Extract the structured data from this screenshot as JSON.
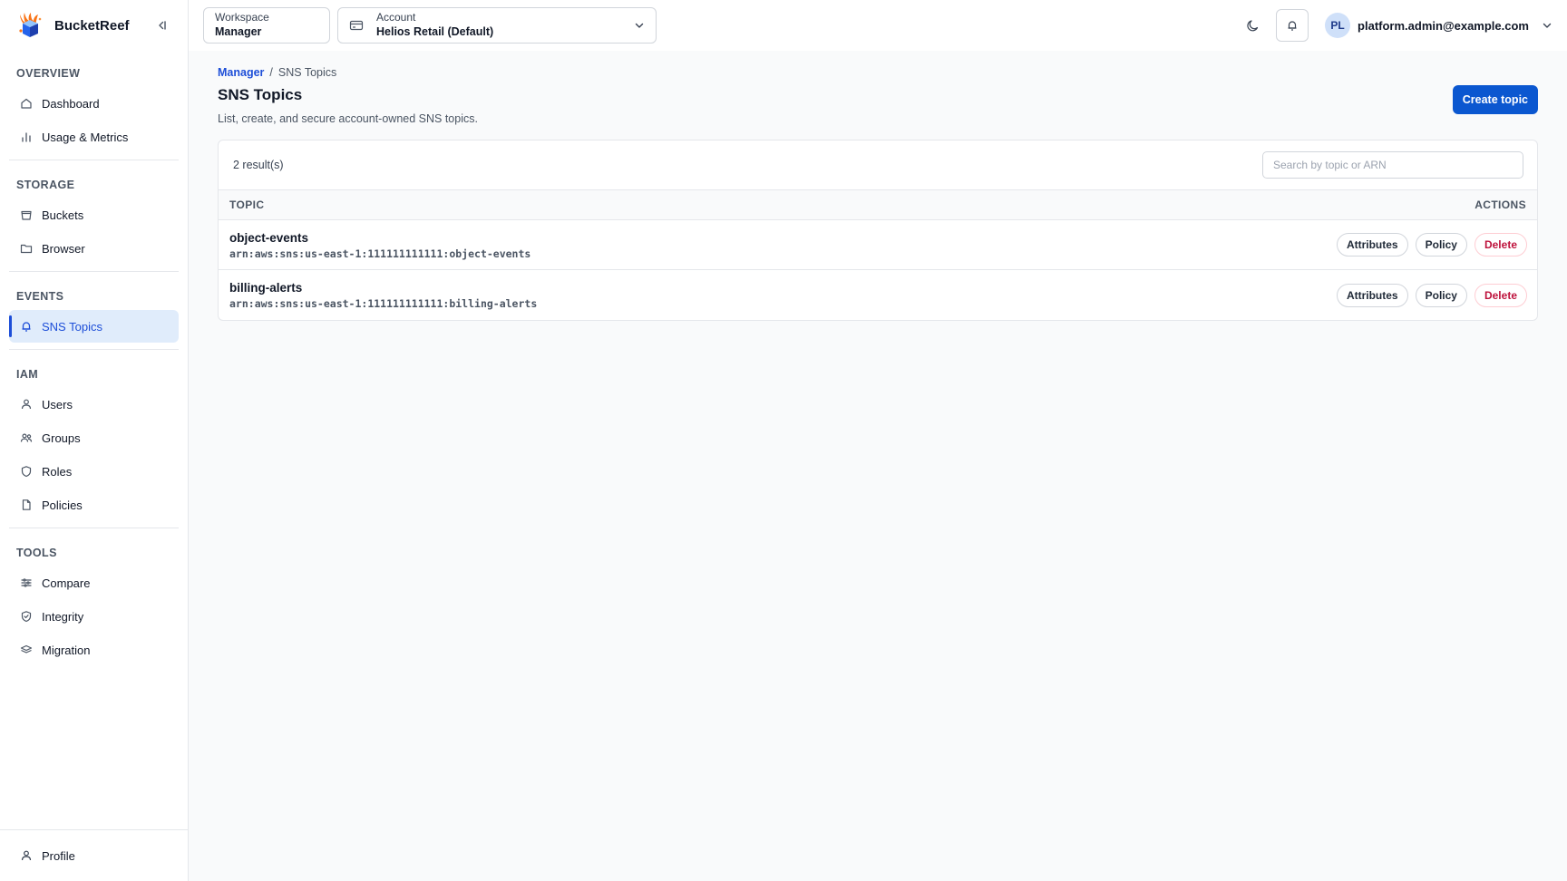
{
  "brand": {
    "name": "BucketReef"
  },
  "sidebar": {
    "sections": [
      {
        "title": "OVERVIEW",
        "items": [
          {
            "label": "Dashboard",
            "icon": "home-icon"
          },
          {
            "label": "Usage & Metrics",
            "icon": "bar-chart-icon"
          }
        ]
      },
      {
        "title": "STORAGE",
        "items": [
          {
            "label": "Buckets",
            "icon": "bucket-icon"
          },
          {
            "label": "Browser",
            "icon": "folder-icon"
          }
        ]
      },
      {
        "title": "EVENTS",
        "items": [
          {
            "label": "SNS Topics",
            "icon": "bell-icon",
            "active": true
          }
        ]
      },
      {
        "title": "IAM",
        "items": [
          {
            "label": "Users",
            "icon": "user-icon"
          },
          {
            "label": "Groups",
            "icon": "users-icon"
          },
          {
            "label": "Roles",
            "icon": "shield-icon"
          },
          {
            "label": "Policies",
            "icon": "file-icon"
          }
        ]
      },
      {
        "title": "TOOLS",
        "items": [
          {
            "label": "Compare",
            "icon": "compare-icon"
          },
          {
            "label": "Integrity",
            "icon": "shield-check-icon"
          },
          {
            "label": "Migration",
            "icon": "layers-icon"
          }
        ]
      }
    ],
    "footer": {
      "label": "Profile",
      "icon": "user-icon"
    }
  },
  "topbar": {
    "workspace": {
      "label": "Workspace",
      "value": "Manager"
    },
    "account": {
      "label": "Account",
      "value": "Helios Retail (Default)"
    },
    "user": {
      "initials": "PL",
      "email": "platform.admin@example.com"
    }
  },
  "breadcrumb": {
    "parent": "Manager",
    "separator": "/",
    "current": "SNS Topics"
  },
  "page": {
    "title": "SNS Topics",
    "subtitle": "List, create, and secure account-owned SNS topics.",
    "create_label": "Create topic"
  },
  "panel": {
    "result_count": "2 result(s)",
    "search_placeholder": "Search by topic or ARN",
    "columns": {
      "topic": "TOPIC",
      "actions": "ACTIONS"
    },
    "rows": [
      {
        "name": "object-events",
        "arn": "arn:aws:sns:us-east-1:111111111111:object-events"
      },
      {
        "name": "billing-alerts",
        "arn": "arn:aws:sns:us-east-1:111111111111:billing-alerts"
      }
    ],
    "actions": {
      "attributes": "Attributes",
      "policy": "Policy",
      "delete": "Delete"
    }
  },
  "colors": {
    "accent": "#0b57d0",
    "danger": "#be123c",
    "active_bg": "#e0ecfb"
  }
}
